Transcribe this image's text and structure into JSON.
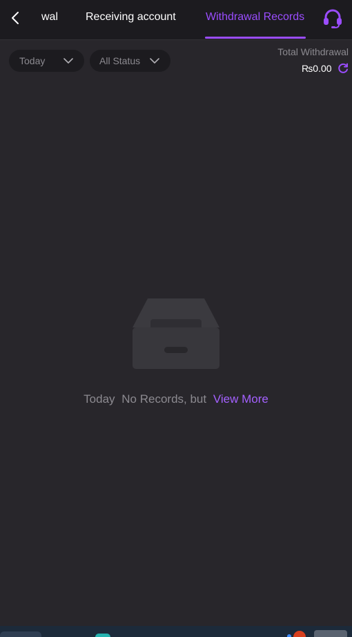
{
  "header": {
    "tabs": [
      {
        "label": "wal",
        "active": false
      },
      {
        "label": "Receiving account",
        "active": false
      },
      {
        "label": "Withdrawal Records",
        "active": true
      }
    ]
  },
  "filters": {
    "date": "Today",
    "status": "All Status"
  },
  "summary": {
    "label": "Total Withdrawal",
    "amount": "₨0.00"
  },
  "empty": {
    "prefix": "Today",
    "message": "No Records, but",
    "link": "View More"
  },
  "colors": {
    "accent": "#9b4dff",
    "background": "#28262b",
    "header_bg": "#1c1b1f"
  },
  "icons": [
    "back-arrow-icon",
    "headset-icon",
    "chevron-down-icon",
    "refresh-icon",
    "empty-box-icon"
  ]
}
